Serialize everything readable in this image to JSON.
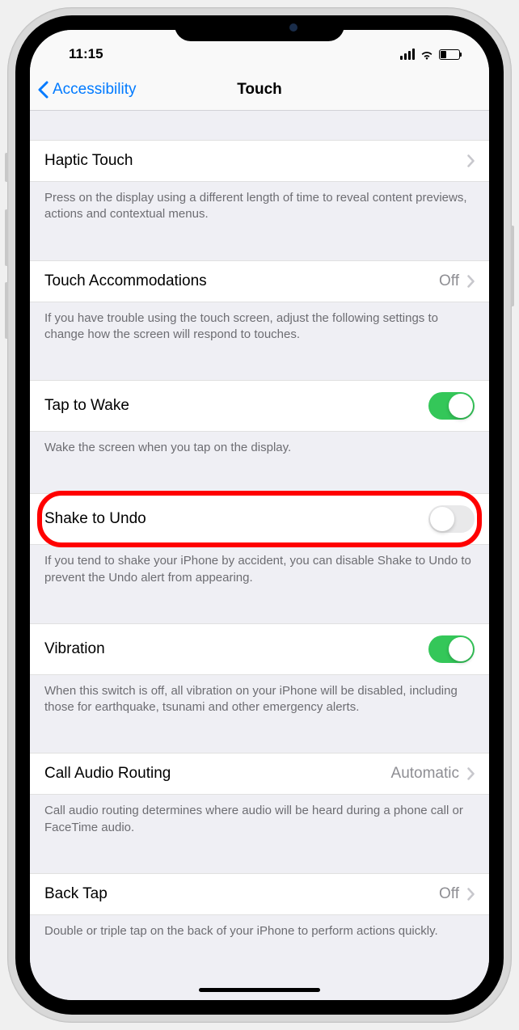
{
  "status": {
    "time": "11:15"
  },
  "nav": {
    "back_label": "Accessibility",
    "title": "Touch"
  },
  "rows": {
    "haptic_touch": {
      "label": "Haptic Touch",
      "footer": "Press on the display using a different length of time to reveal content previews, actions and contextual menus."
    },
    "touch_accommodations": {
      "label": "Touch Accommodations",
      "value": "Off",
      "footer": "If you have trouble using the touch screen, adjust the following settings to change how the screen will respond to touches."
    },
    "tap_to_wake": {
      "label": "Tap to Wake",
      "footer": "Wake the screen when you tap on the display."
    },
    "shake_to_undo": {
      "label": "Shake to Undo",
      "footer": "If you tend to shake your iPhone by accident, you can disable Shake to Undo to prevent the Undo alert from appearing."
    },
    "vibration": {
      "label": "Vibration",
      "footer": "When this switch is off, all vibration on your iPhone will be disabled, including those for earthquake, tsunami and other emergency alerts."
    },
    "call_audio_routing": {
      "label": "Call Audio Routing",
      "value": "Automatic",
      "footer": "Call audio routing determines where audio will be heard during a phone call or FaceTime audio."
    },
    "back_tap": {
      "label": "Back Tap",
      "value": "Off",
      "footer": "Double or triple tap on the back of your iPhone to perform actions quickly."
    }
  }
}
